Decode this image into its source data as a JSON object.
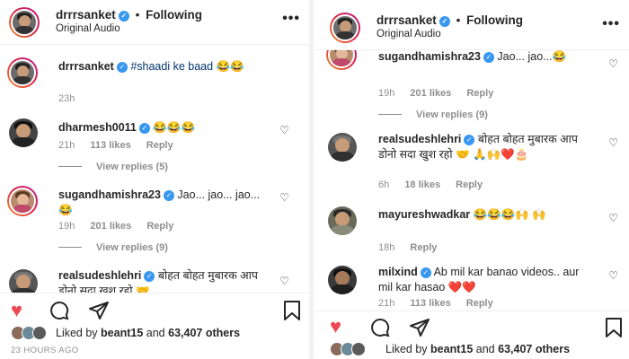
{
  "post": {
    "username": "drrrsanket",
    "separator": "•",
    "following": "Following",
    "audio": "Original Audio",
    "more": "•••",
    "liked_prefix": "Liked by",
    "liked_user": "beant15",
    "liked_and": "and",
    "liked_count": "63,407 others",
    "posted_time": "23 HOURS AGO"
  },
  "left": {
    "caption": {
      "user": "drrrsanket",
      "tag": "#shaadi ke baad",
      "emoji": "😂😂",
      "time": "23h"
    },
    "comments": [
      {
        "user": "dharmesh0011",
        "text": "😂😂😂",
        "time": "21h",
        "likes": "113 likes",
        "reply": "Reply",
        "views": "View replies (5)"
      },
      {
        "user": "sugandhamishra23",
        "text": "Jao... jao... jao...😂",
        "time": "19h",
        "likes": "201 likes",
        "reply": "Reply",
        "views": "View replies (9)"
      },
      {
        "user": "realsudeshlehri",
        "text": "बोहत बोहत मुबारक आप डोनो सदा खुश रहो 🤝"
      }
    ]
  },
  "right": {
    "comments": [
      {
        "user": "sugandhamishra23",
        "text": "Jao... jao...😂",
        "time": "19h",
        "likes": "201 likes",
        "reply": "Reply",
        "views": "View replies (9)"
      },
      {
        "user": "realsudeshlehri",
        "text": "बोहत बोहत मुबारक आप डोनो सदा खुश रहो 🤝 🙏🙌❤️🎂",
        "time": "6h",
        "likes": "18 likes",
        "reply": "Reply"
      },
      {
        "user": "mayureshwadkar",
        "text": "😂😂😂🙌 🙌",
        "time": "18h",
        "reply": "Reply"
      },
      {
        "user": "milxind",
        "text": "Ab mil kar banao videos.. aur mil kar hasao ❤️❤️",
        "time": "21h",
        "likes": "113 likes",
        "reply": "Reply"
      }
    ]
  },
  "icons": {
    "like": "heart-filled-icon",
    "comment": "comment-icon",
    "share": "send-icon",
    "save": "bookmark-icon"
  },
  "colors": {
    "accent": "#ed4956",
    "verified": "#3897f0",
    "muted": "#8e8e8e"
  }
}
